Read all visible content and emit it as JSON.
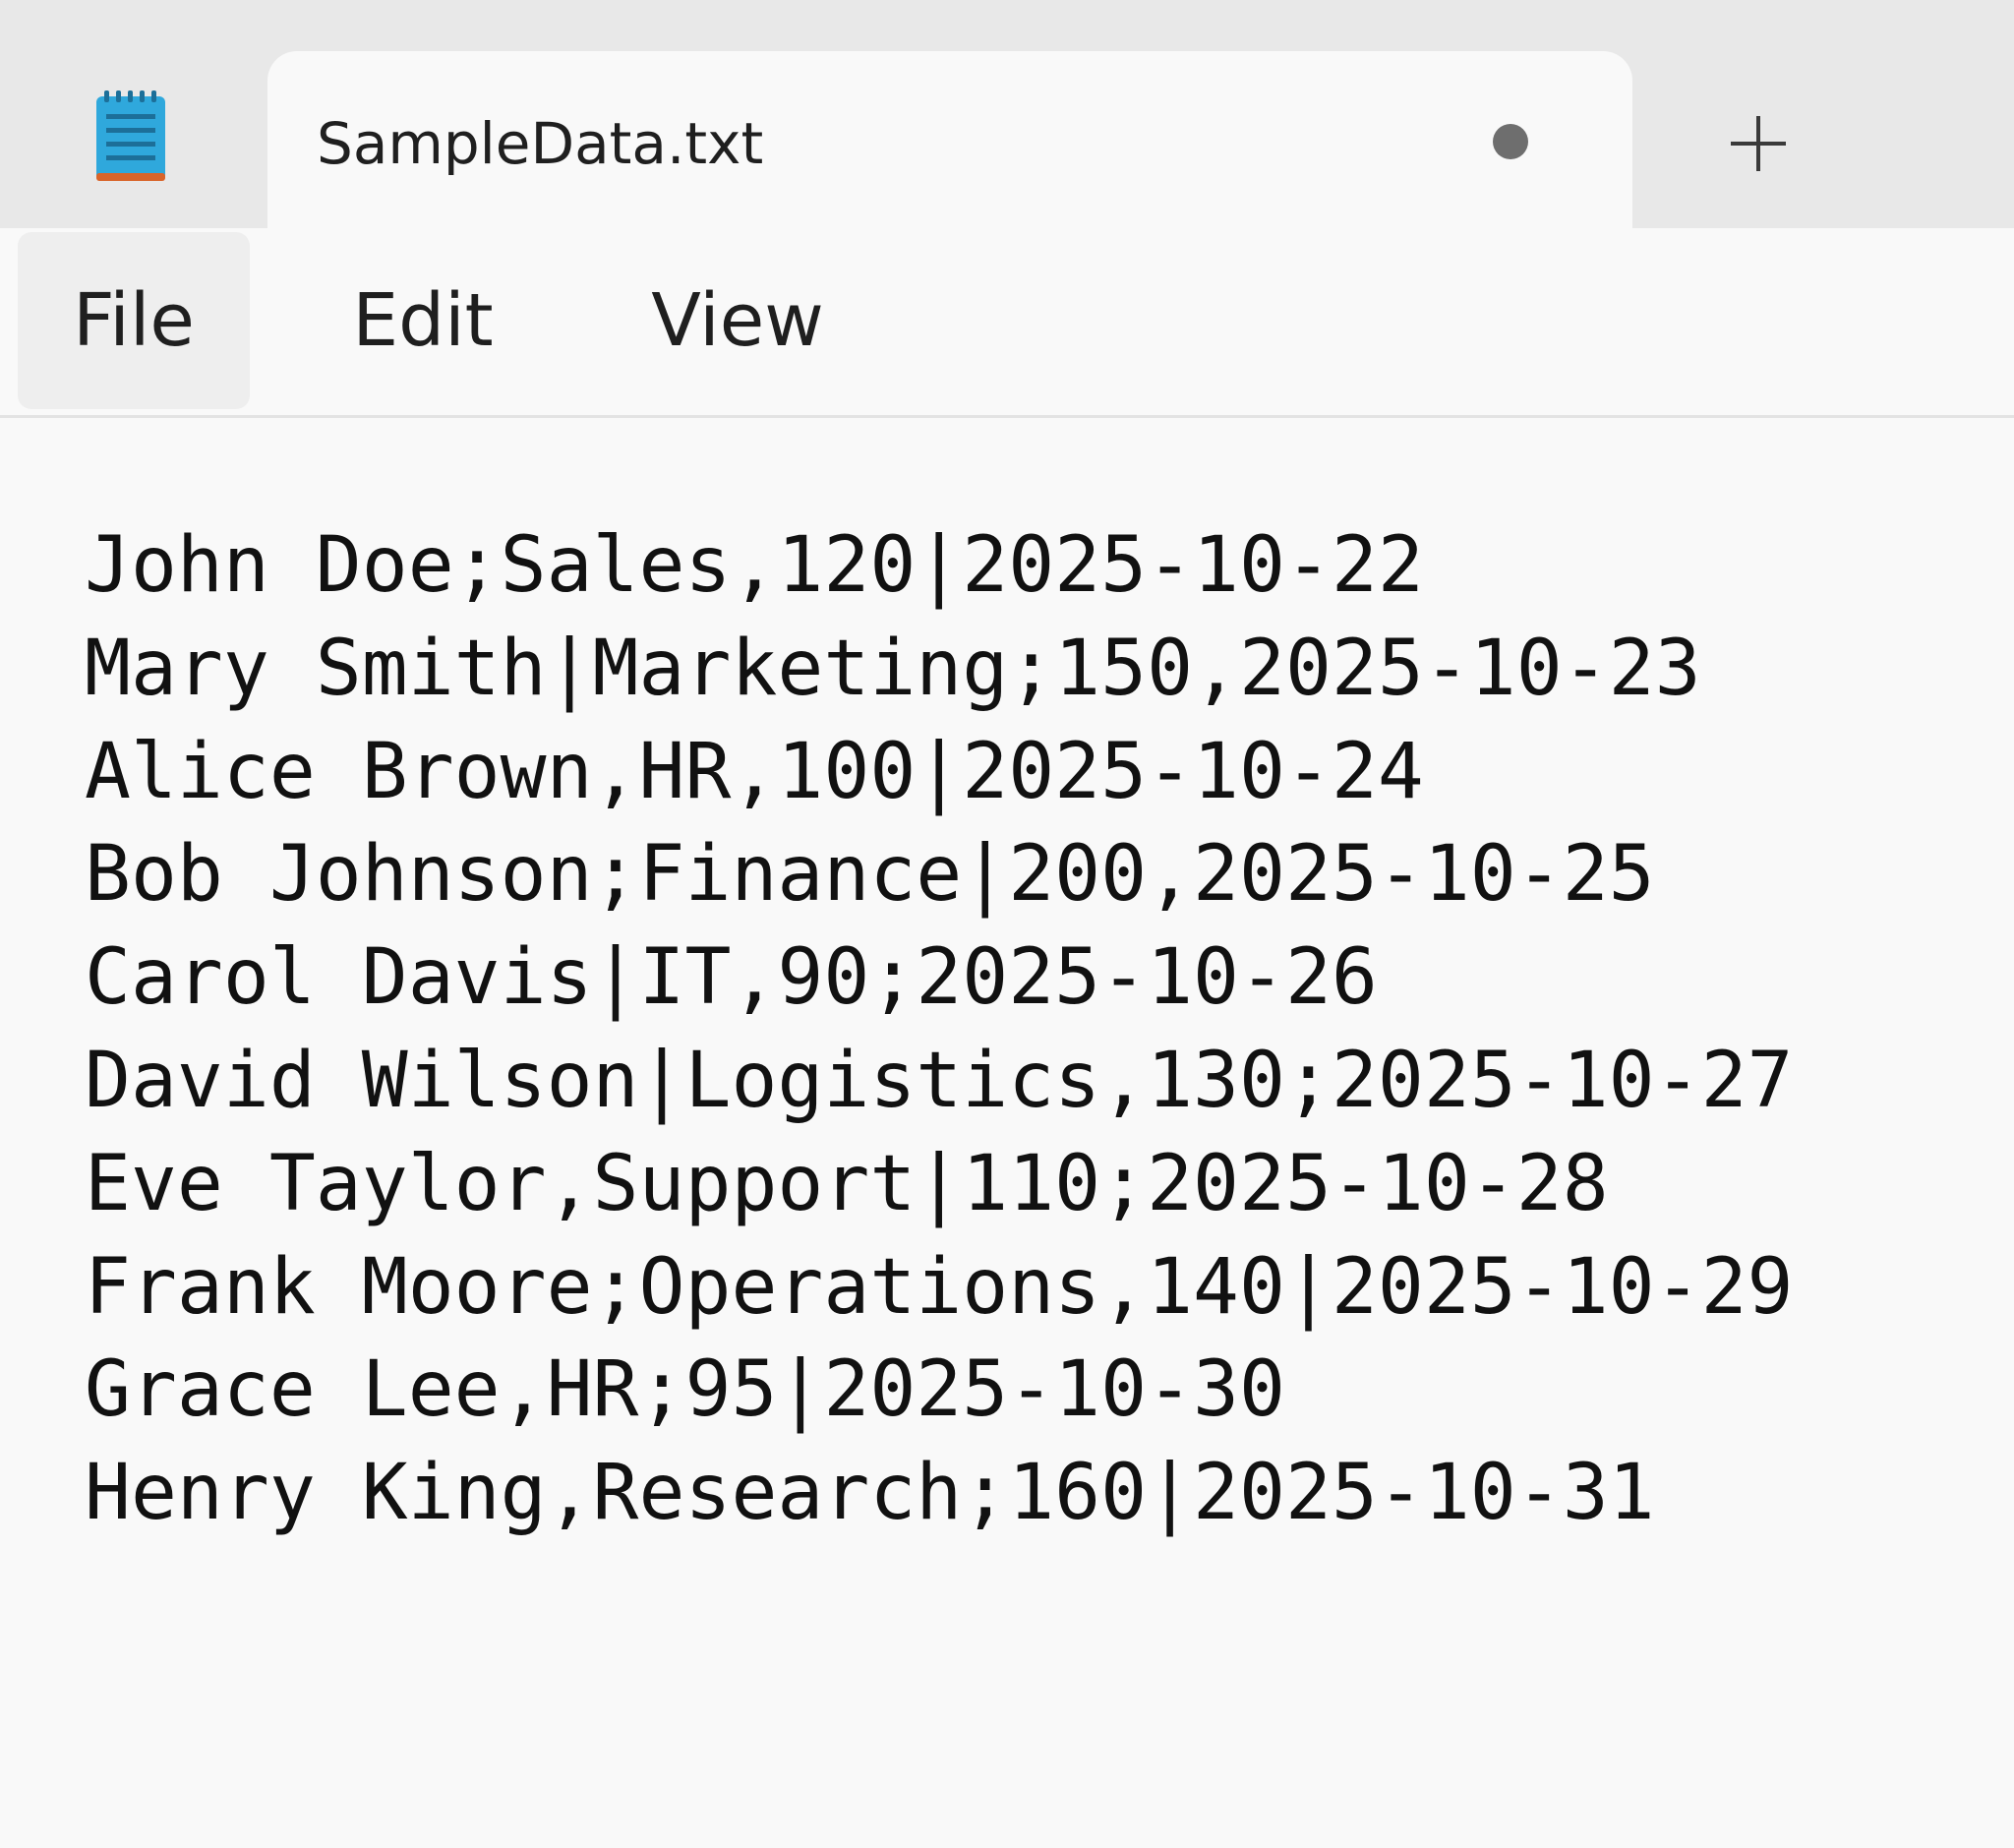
{
  "tab": {
    "title": "SampleData.txt",
    "unsaved": true
  },
  "icons": {
    "app": "notepad-icon",
    "unsaved": "unsaved-dot-icon",
    "new_tab": "plus-icon"
  },
  "menu": {
    "file": "File",
    "edit": "Edit",
    "view": "View"
  },
  "editor": {
    "lines": [
      "John Doe;Sales,120|2025-10-22",
      "Mary Smith|Marketing;150,2025-10-23",
      "Alice Brown,HR,100|2025-10-24",
      "Bob Johnson;Finance|200,2025-10-25",
      "Carol Davis|IT,90;2025-10-26",
      "David Wilson|Logistics,130;2025-10-27",
      "Eve Taylor,Support|110;2025-10-28",
      "Frank Moore;Operations,140|2025-10-29",
      "Grace Lee,HR;95|2025-10-30",
      "Henry King,Research;160|2025-10-31"
    ]
  },
  "colors": {
    "tabstrip_bg": "#e8e8e8",
    "content_bg": "#f9f9f9",
    "text": "#111111",
    "icon_blue": "#2fa8dc",
    "icon_orange": "#d9642a"
  }
}
